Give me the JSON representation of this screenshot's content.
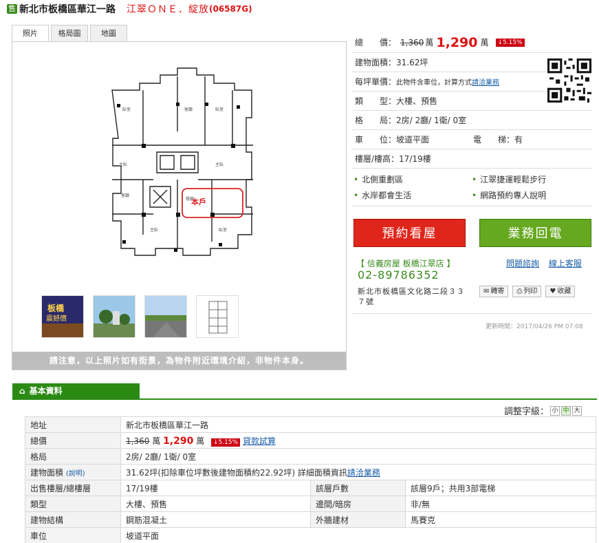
{
  "title": {
    "badge": "售",
    "address": "新北市板橋區華江一路",
    "name": "江翠ＯＮＥ．綻放",
    "code": "(06587G)"
  },
  "photo": {
    "tabs": [
      "照片",
      "格局圖",
      "地圖"
    ],
    "active_tab": 0,
    "marker": "本戶",
    "note": "請注意，以上照片如有街景，為物件附近環境介紹，非物件本身。"
  },
  "info": {
    "price_label": "總　　價：",
    "price_old": "1,360",
    "price_unit": "萬",
    "price_new": "1,290",
    "price_drop": "↓5.15%",
    "area_label": "建物面積：",
    "area_value": "31.62坪",
    "unit_price_label": "每坪單價：",
    "unit_price_note": "此物件含車位，計算方式",
    "unit_price_link": "請洽業務",
    "type_label": "類　　型：",
    "type_value": "大樓、預售",
    "layout_label": "格　　局：",
    "layout_value": "2房/ 2廳/ 1衛/ 0室",
    "parking_label": "車　　位：",
    "parking_value": "坡道平面",
    "elevator_label": "電　　梯：",
    "elevator_value": "有",
    "floor_label": "樓層/樓高：",
    "floor_value": "17/19樓"
  },
  "features": [
    "北側重劃區",
    "江翠捷運輕鬆步行",
    "水岸都會生活",
    "網路預約專人說明"
  ],
  "buttons": {
    "book": "預約看屋",
    "call": "業務回電"
  },
  "agent": {
    "store": "【 信義房屋 板橋江翠店 】",
    "phone": "02-89786352",
    "address": "新北市板橋區文化路二段３３７號",
    "link_ask": "問題諮詢",
    "link_service": "線上客服",
    "share": "轉寄",
    "print": "列印",
    "favorite": "收藏"
  },
  "update_time": "更新時間：2017/04/26 PM 07:08",
  "basic": {
    "header": "基本資料",
    "font_size_label": "調整字級：",
    "font_sizes": [
      "小",
      "中",
      "大"
    ],
    "rows": {
      "address_k": "地址",
      "address_v": "新北市板橋區華江一路",
      "price_k": "總價",
      "price_old": "1,360",
      "price_unit": "萬",
      "price_new": "1,290",
      "price_drop": "↓5.15%",
      "loan_link": "貸款試算",
      "layout_k": "格局",
      "layout_v": "2房/ 2廳/ 1衛/ 0室",
      "area_k": "建物面積",
      "area_note": "(說明)",
      "area_v": "31.62坪(扣除車位坪數後建物面積約22.92坪) 詳細面積資訊",
      "area_link": "請洽業務",
      "floor_k": "出售樓層/總樓層",
      "floor_v": "17/19樓",
      "units_k": "該層戶數",
      "units_v": "該層9戶；共用3部電梯",
      "type_k": "類型",
      "type_v": "大樓、預售",
      "side_k": "邊間/暗房",
      "side_v": "非/無",
      "struct_k": "建物結構",
      "struct_v": "鋼筋混凝土",
      "wall_k": "外牆建材",
      "wall_v": "馬賽克",
      "parking_k": "車位",
      "parking_v": "坡道平面"
    }
  }
}
